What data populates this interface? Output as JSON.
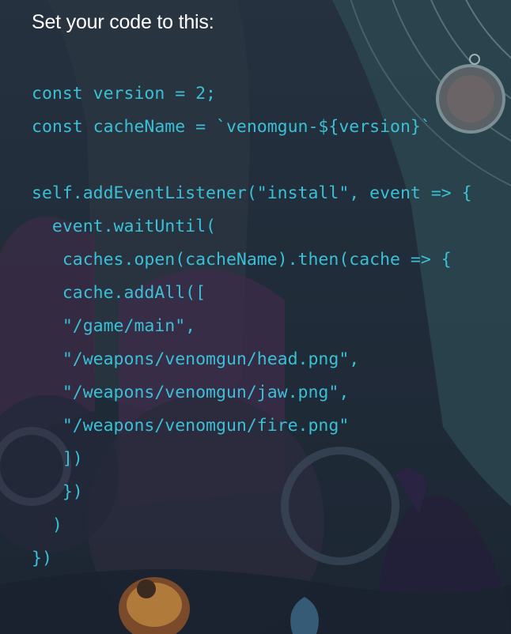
{
  "instruction": "Set your code to this:",
  "code_lines": [
    "const version = 2;",
    "const cacheName = `venomgun-${version}`",
    "",
    "self.addEventListener(\"install\", event => {",
    "  event.waitUntil(",
    "   caches.open(cacheName).then(cache => {",
    "   cache.addAll([",
    "   \"/game/main\",",
    "   \"/weapons/venomgun/head.png\",",
    "   \"/weapons/venomgun/jaw.png\",",
    "   \"/weapons/venomgun/fire.png\"",
    "   ])",
    "   })",
    "  )",
    "})"
  ],
  "colors": {
    "background": "#1f2d3a",
    "code_text": "#3ac0d6",
    "instruction_text": "#ffffff"
  }
}
